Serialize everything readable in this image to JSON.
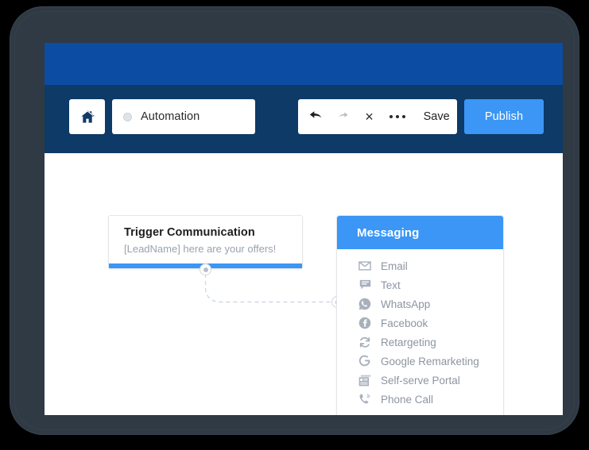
{
  "device": {
    "name": "tablet-device-frame"
  },
  "app": {
    "brand_band": {
      "name": "brand-band",
      "color": "#0c4ca3"
    },
    "toolbar_color": "#0d3a66",
    "accent_color": "#3b96f5"
  },
  "toolbar": {
    "home_icon": "home-icon",
    "automation": {
      "label": "Automation",
      "status_dot": "radio-dot"
    },
    "undo_label": "undo-icon",
    "redo_label": "redo-icon",
    "close_label": "×",
    "more_label": "more-options-icon",
    "save_label": "Save",
    "publish_label": "Publish"
  },
  "canvas": {
    "trigger_card": {
      "title": "Trigger Communication",
      "subtitle": "[LeadName] here are your offers!",
      "bar_color": "#3b96f5"
    },
    "connector": {
      "source_node": "connector-node-source",
      "target_node": "connector-node-target",
      "style": "dashed"
    }
  },
  "messaging_panel": {
    "header": "Messaging",
    "items": [
      {
        "label": "Email",
        "icon": "envelope-icon"
      },
      {
        "label": "Text",
        "icon": "chat-bubble-icon"
      },
      {
        "label": "WhatsApp",
        "icon": "whatsapp-icon"
      },
      {
        "label": "Facebook",
        "icon": "facebook-icon"
      },
      {
        "label": "Retargeting",
        "icon": "refresh-cycle-icon"
      },
      {
        "label": "Google Remarketing",
        "icon": "google-g-icon"
      },
      {
        "label": "Self-serve Portal",
        "icon": "portal-window-icon"
      },
      {
        "label": "Phone Call",
        "icon": "phone-call-icon"
      }
    ]
  }
}
